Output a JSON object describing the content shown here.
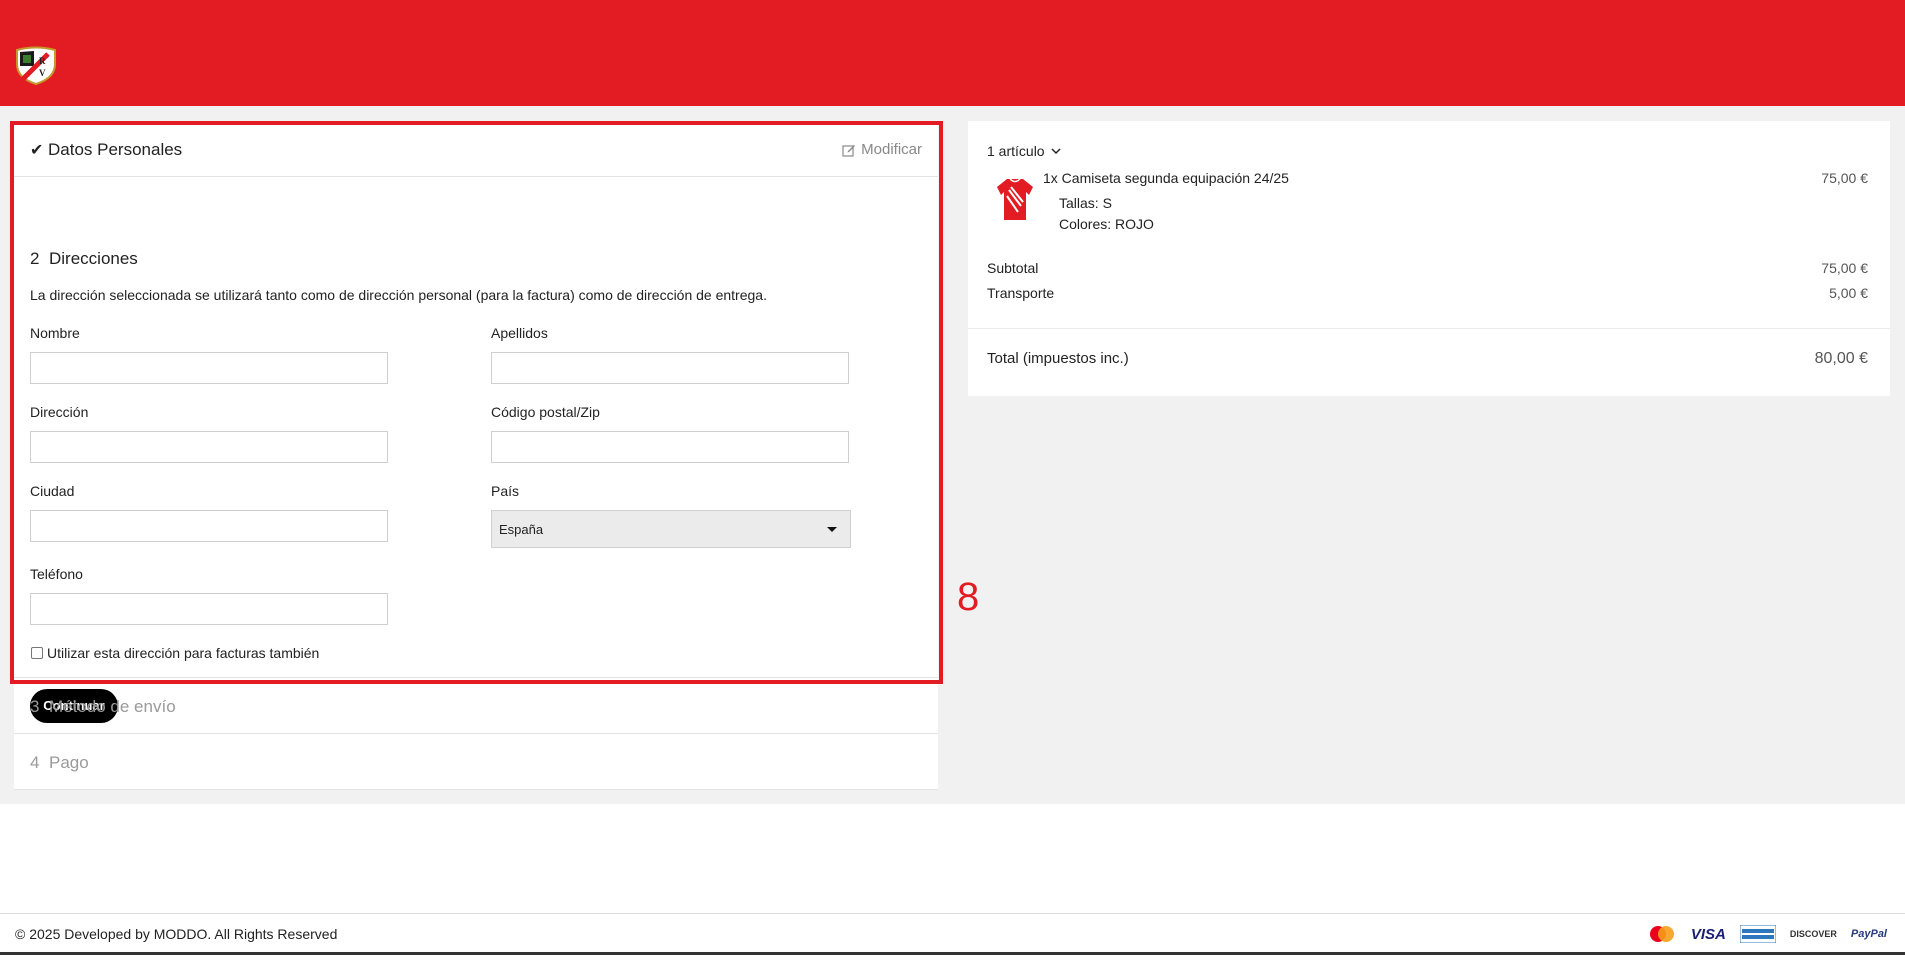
{
  "header": {
    "logo_alt": "Rayo Vallecano crest",
    "brand_color": "#e31b23"
  },
  "checkout": {
    "step1": {
      "title": "Datos Personales",
      "modify": "Modificar"
    },
    "step2": {
      "number": "2",
      "title": "Direcciones",
      "description": "La dirección seleccionada se utilizará tanto como de dirección personal (para la factura) como de dirección de entrega.",
      "fields": {
        "nombre": "Nombre",
        "apellidos": "Apellidos",
        "direccion": "Dirección",
        "codigo_postal": "Código postal/Zip",
        "ciudad": "Ciudad",
        "pais": "País",
        "telefono": "Teléfono"
      },
      "pais_value": "España",
      "checkbox_label": "Utilizar esta dirección para facturas también",
      "continue": "Continuar"
    },
    "step3": {
      "number": "3",
      "title": "Método de envío"
    },
    "step4": {
      "number": "4",
      "title": "Pago"
    }
  },
  "annotation": {
    "label": "8",
    "color": "#e31b23"
  },
  "summary": {
    "items_count": "1 artículo",
    "item": {
      "name": "1x Camiseta segunda equipación 24/25",
      "price": "75,00 €",
      "size": "Tallas: S",
      "color": "Colores: ROJO"
    },
    "subtotal_label": "Subtotal",
    "subtotal_value": "75,00 €",
    "shipping_label": "Transporte",
    "shipping_value": "5,00 €",
    "total_label": "Total (impuestos inc.)",
    "total_value": "80,00 €"
  },
  "footer": {
    "copyright": "© 2025 Developed by MODDO. All Rights Reserved",
    "payments": [
      "mastercard-icon",
      "visa-icon",
      "amex-icon",
      "discover-icon",
      "paypal-icon"
    ],
    "visa": "VISA",
    "discover": "DISCOVER",
    "paypal": "PayPal"
  }
}
